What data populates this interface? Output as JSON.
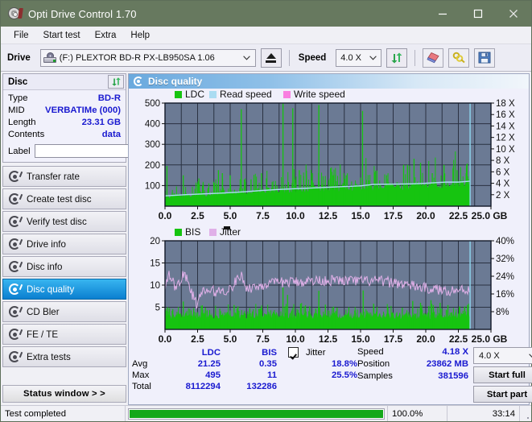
{
  "window": {
    "title": "Opti Drive Control 1.70",
    "icon": "disc-icon",
    "minimize": "minimize-icon",
    "maximize": "maximize-icon",
    "close": "close-icon"
  },
  "menu": {
    "items": [
      "File",
      "Start test",
      "Extra",
      "Help"
    ]
  },
  "toolbar": {
    "drive_label": "Drive",
    "drive_value": "(F:)   PLEXTOR BD-R  PX-LB950SA 1.06",
    "eject": "eject-icon",
    "speed_label": "Speed",
    "speed_value": "4.0 X",
    "refresh": "refresh-icon",
    "erase": "eraser-icon",
    "bookmark": "keys-icon",
    "save": "save-icon"
  },
  "disc_panel": {
    "header": "Disc",
    "refresh_icon": "refresh-icon",
    "rows": [
      {
        "key": "Type",
        "value": "BD-R"
      },
      {
        "key": "MID",
        "value": "VERBATIMe (000)"
      },
      {
        "key": "Length",
        "value": "23.31 GB"
      },
      {
        "key": "Contents",
        "value": "data"
      }
    ],
    "label_key": "Label",
    "label_value": "",
    "label_placeholder": "",
    "label_button_icon": "cd-icon"
  },
  "sidebar": {
    "items": [
      {
        "label": "Transfer rate",
        "icon": "disc-test-icon",
        "active": false
      },
      {
        "label": "Create test disc",
        "icon": "disc-test-icon",
        "active": false
      },
      {
        "label": "Verify test disc",
        "icon": "disc-test-icon",
        "active": false
      },
      {
        "label": "Drive info",
        "icon": "disc-test-icon",
        "active": false
      },
      {
        "label": "Disc info",
        "icon": "disc-test-icon",
        "active": false
      },
      {
        "label": "Disc quality",
        "icon": "disc-test-icon",
        "active": true
      },
      {
        "label": "CD Bler",
        "icon": "disc-test-icon",
        "active": false
      },
      {
        "label": "FE / TE",
        "icon": "disc-test-icon",
        "active": false
      },
      {
        "label": "Extra tests",
        "icon": "disc-test-icon",
        "active": false
      }
    ],
    "status_window_button": "Status window > >"
  },
  "panel": {
    "title": "Disc quality",
    "icon": "disc-quality-icon"
  },
  "stats": {
    "col_headers": [
      "LDC",
      "BIS"
    ],
    "jitter_label": "Jitter",
    "jitter_checked": true,
    "rows": [
      {
        "key": "Avg",
        "ldc": "21.25",
        "bis": "0.35",
        "jitter": "18.8%"
      },
      {
        "key": "Max",
        "ldc": "495",
        "bis": "11",
        "jitter": "25.5%"
      },
      {
        "key": "Total",
        "ldc": "8112294",
        "bis": "132286",
        "jitter": ""
      }
    ],
    "speed_key": "Speed",
    "speed_value": "4.18 X",
    "position_key": "Position",
    "position_value": "23862 MB",
    "samples_key": "Samples",
    "samples_value": "381596",
    "speed_select": "4.0 X",
    "start_full": "Start full",
    "start_part": "Start part"
  },
  "statusbar": {
    "message": "Test completed",
    "percent_text": "100.0%",
    "percent_value": 100,
    "time": "33:14"
  },
  "colors": {
    "titlebar": "#67795f",
    "accent_blue": "#0b7fd0",
    "plot_bg": "#6b7a94",
    "ldc_green": "#16c410",
    "read_speed": "#aadcf2",
    "write_speed": "#f97fe0",
    "jitter_pink": "#e0b0e8",
    "value_text": "#1a1ad0",
    "progress_green": "#14a81a"
  },
  "chart_data": [
    {
      "type": "area",
      "title": "Disc quality - LDC / Read speed",
      "xlabel": "GB",
      "ylabel": "LDC",
      "xlim": [
        0,
        25
      ],
      "xticks": [
        "0.0",
        "2.5",
        "5.0",
        "7.5",
        "10.0",
        "12.5",
        "15.0",
        "17.5",
        "20.0",
        "22.5",
        "25.0 GB"
      ],
      "ylim": [
        0,
        500
      ],
      "yticks": [
        100,
        200,
        300,
        400,
        500
      ],
      "y2label": "Speed",
      "y2lim": [
        0,
        18
      ],
      "y2ticks": [
        "2 X",
        "4 X",
        "6 X",
        "8 X",
        "10 X",
        "12 X",
        "14 X",
        "16 X",
        "18 X"
      ],
      "grid": true,
      "legend": [
        {
          "name": "LDC",
          "color": "#16c410"
        },
        {
          "name": "Read speed",
          "color": "#aadcf2"
        },
        {
          "name": "Write speed",
          "color": "#f97fe0"
        }
      ],
      "data_end_gb": 23.4,
      "series": [
        {
          "name": "LDC",
          "color": "#16c410",
          "kind": "spikes",
          "baseline": [
            55,
            48,
            45,
            52,
            50,
            47,
            55,
            58,
            52,
            50,
            56,
            60,
            55,
            52,
            58,
            62,
            60,
            58,
            62,
            65,
            60,
            62,
            66,
            64,
            62,
            68,
            70,
            66,
            64,
            70,
            72,
            68,
            70,
            74,
            72,
            70,
            75,
            78,
            74,
            72,
            76,
            80,
            78,
            75,
            80,
            82,
            78,
            80,
            84,
            82,
            80,
            85,
            86,
            82,
            84,
            88,
            86,
            84,
            88,
            90,
            86,
            88,
            92,
            90,
            88,
            92,
            94,
            90,
            92,
            96,
            94,
            90,
            94,
            96,
            92,
            94,
            98,
            96,
            94,
            98,
            100,
            96,
            98,
            102,
            100,
            96,
            100,
            104,
            100,
            98,
            102,
            106,
            102,
            100,
            104,
            108,
            104,
            100,
            105,
            108
          ],
          "spikes": [
            {
              "x": 0.15,
              "y": 195
            },
            {
              "x": 1.4,
              "y": 150
            },
            {
              "x": 2.6,
              "y": 135
            },
            {
              "x": 4.1,
              "y": 175
            },
            {
              "x": 4.4,
              "y": 160
            },
            {
              "x": 5.0,
              "y": 150
            },
            {
              "x": 5.85,
              "y": 470
            },
            {
              "x": 6.6,
              "y": 130
            },
            {
              "x": 7.4,
              "y": 160
            },
            {
              "x": 9.05,
              "y": 500
            },
            {
              "x": 9.8,
              "y": 475
            },
            {
              "x": 10.3,
              "y": 175
            },
            {
              "x": 11.3,
              "y": 160
            },
            {
              "x": 11.8,
              "y": 490
            },
            {
              "x": 12.9,
              "y": 150
            },
            {
              "x": 13.9,
              "y": 150
            },
            {
              "x": 15.15,
              "y": 462
            },
            {
              "x": 16.1,
              "y": 165
            },
            {
              "x": 17.0,
              "y": 150
            },
            {
              "x": 18.3,
              "y": 200
            },
            {
              "x": 18.6,
              "y": 200
            },
            {
              "x": 19.1,
              "y": 230
            },
            {
              "x": 19.6,
              "y": 210
            },
            {
              "x": 20.5,
              "y": 160
            },
            {
              "x": 21.4,
              "y": 200
            },
            {
              "x": 22.4,
              "y": 175
            },
            {
              "x": 23.1,
              "y": 160
            }
          ]
        },
        {
          "name": "Read speed",
          "color": "#aadcf2",
          "kind": "line",
          "points": [
            {
              "x": 0.0,
              "y": 1.8
            },
            {
              "x": 1.5,
              "y": 2.0
            },
            {
              "x": 3.0,
              "y": 2.15
            },
            {
              "x": 4.5,
              "y": 2.3
            },
            {
              "x": 6.0,
              "y": 2.5
            },
            {
              "x": 7.5,
              "y": 2.75
            },
            {
              "x": 9.0,
              "y": 2.95
            },
            {
              "x": 10.5,
              "y": 3.1
            },
            {
              "x": 12.0,
              "y": 3.25
            },
            {
              "x": 13.5,
              "y": 3.4
            },
            {
              "x": 15.0,
              "y": 3.55
            },
            {
              "x": 16.0,
              "y": 3.8
            },
            {
              "x": 17.5,
              "y": 3.85
            },
            {
              "x": 19.0,
              "y": 3.9
            },
            {
              "x": 20.0,
              "y": 4.0
            },
            {
              "x": 21.5,
              "y": 4.2
            },
            {
              "x": 22.5,
              "y": 4.2
            },
            {
              "x": 23.3,
              "y": 4.35
            }
          ]
        }
      ]
    },
    {
      "type": "area",
      "title": "Disc quality - BIS / Jitter",
      "xlabel": "GB",
      "ylabel": "BIS",
      "xlim": [
        0,
        25
      ],
      "xticks": [
        "0.0",
        "2.5",
        "5.0",
        "7.5",
        "10.0",
        "12.5",
        "15.0",
        "17.5",
        "20.0",
        "22.5",
        "25.0 GB"
      ],
      "ylim": [
        0,
        20
      ],
      "yticks": [
        5,
        10,
        15,
        20
      ],
      "y2label": "Jitter",
      "y2lim": [
        0,
        40
      ],
      "y2ticks": [
        "8%",
        "16%",
        "24%",
        "32%",
        "40%"
      ],
      "grid": true,
      "legend": [
        {
          "name": "BIS",
          "color": "#16c410"
        },
        {
          "name": "Jitter",
          "color": "#e0b0e8"
        }
      ],
      "data_end_gb": 23.4,
      "series": [
        {
          "name": "BIS",
          "color": "#16c410",
          "kind": "spikes",
          "baseline_level": 3.0,
          "spikes": [
            {
              "x": 0.2,
              "y": 5.0
            },
            {
              "x": 0.6,
              "y": 4.6
            },
            {
              "x": 1.4,
              "y": 6.3
            },
            {
              "x": 2.2,
              "y": 4.8
            },
            {
              "x": 3.1,
              "y": 4.9
            },
            {
              "x": 4.2,
              "y": 4.7
            },
            {
              "x": 5.3,
              "y": 5.5
            },
            {
              "x": 5.6,
              "y": 5.2
            },
            {
              "x": 6.5,
              "y": 4.8
            },
            {
              "x": 7.4,
              "y": 5.1
            },
            {
              "x": 9.05,
              "y": 9.5
            },
            {
              "x": 9.4,
              "y": 7.8
            },
            {
              "x": 10.4,
              "y": 5.8
            },
            {
              "x": 11.1,
              "y": 5.2
            },
            {
              "x": 11.8,
              "y": 8.7
            },
            {
              "x": 12.3,
              "y": 5.6
            },
            {
              "x": 13.2,
              "y": 4.9
            },
            {
              "x": 14.1,
              "y": 5.0
            },
            {
              "x": 15.2,
              "y": 8.8
            },
            {
              "x": 16.0,
              "y": 5.8
            },
            {
              "x": 17.1,
              "y": 5.0
            },
            {
              "x": 18.2,
              "y": 4.9
            },
            {
              "x": 19.0,
              "y": 6.4
            },
            {
              "x": 19.6,
              "y": 6.0
            },
            {
              "x": 20.4,
              "y": 6.6
            },
            {
              "x": 21.1,
              "y": 6.0
            },
            {
              "x": 21.7,
              "y": 5.5
            },
            {
              "x": 22.6,
              "y": 5.2
            },
            {
              "x": 23.2,
              "y": 5.5
            }
          ]
        },
        {
          "name": "Jitter",
          "color": "#e0b0e8",
          "kind": "noisy-line",
          "points": [
            {
              "x": 0.0,
              "y": 8.6
            },
            {
              "x": 0.3,
              "y": 12.8
            },
            {
              "x": 0.8,
              "y": 9.4
            },
            {
              "x": 1.5,
              "y": 12.6
            },
            {
              "x": 2.0,
              "y": 8.6
            },
            {
              "x": 2.4,
              "y": 5.8
            },
            {
              "x": 3.0,
              "y": 8.7
            },
            {
              "x": 4.0,
              "y": 8.6
            },
            {
              "x": 5.0,
              "y": 9.0
            },
            {
              "x": 5.8,
              "y": 12.3
            },
            {
              "x": 6.3,
              "y": 9.3
            },
            {
              "x": 7.0,
              "y": 9.6
            },
            {
              "x": 7.8,
              "y": 10.2
            },
            {
              "x": 9.0,
              "y": 10.6
            },
            {
              "x": 10.5,
              "y": 10.8
            },
            {
              "x": 12.0,
              "y": 11.1
            },
            {
              "x": 13.5,
              "y": 11.0
            },
            {
              "x": 15.0,
              "y": 10.9
            },
            {
              "x": 16.5,
              "y": 10.9
            },
            {
              "x": 18.0,
              "y": 10.4
            },
            {
              "x": 19.0,
              "y": 9.8
            },
            {
              "x": 20.0,
              "y": 9.3
            },
            {
              "x": 21.0,
              "y": 8.9
            },
            {
              "x": 22.0,
              "y": 8.8
            },
            {
              "x": 23.3,
              "y": 9.0
            }
          ]
        }
      ]
    }
  ]
}
